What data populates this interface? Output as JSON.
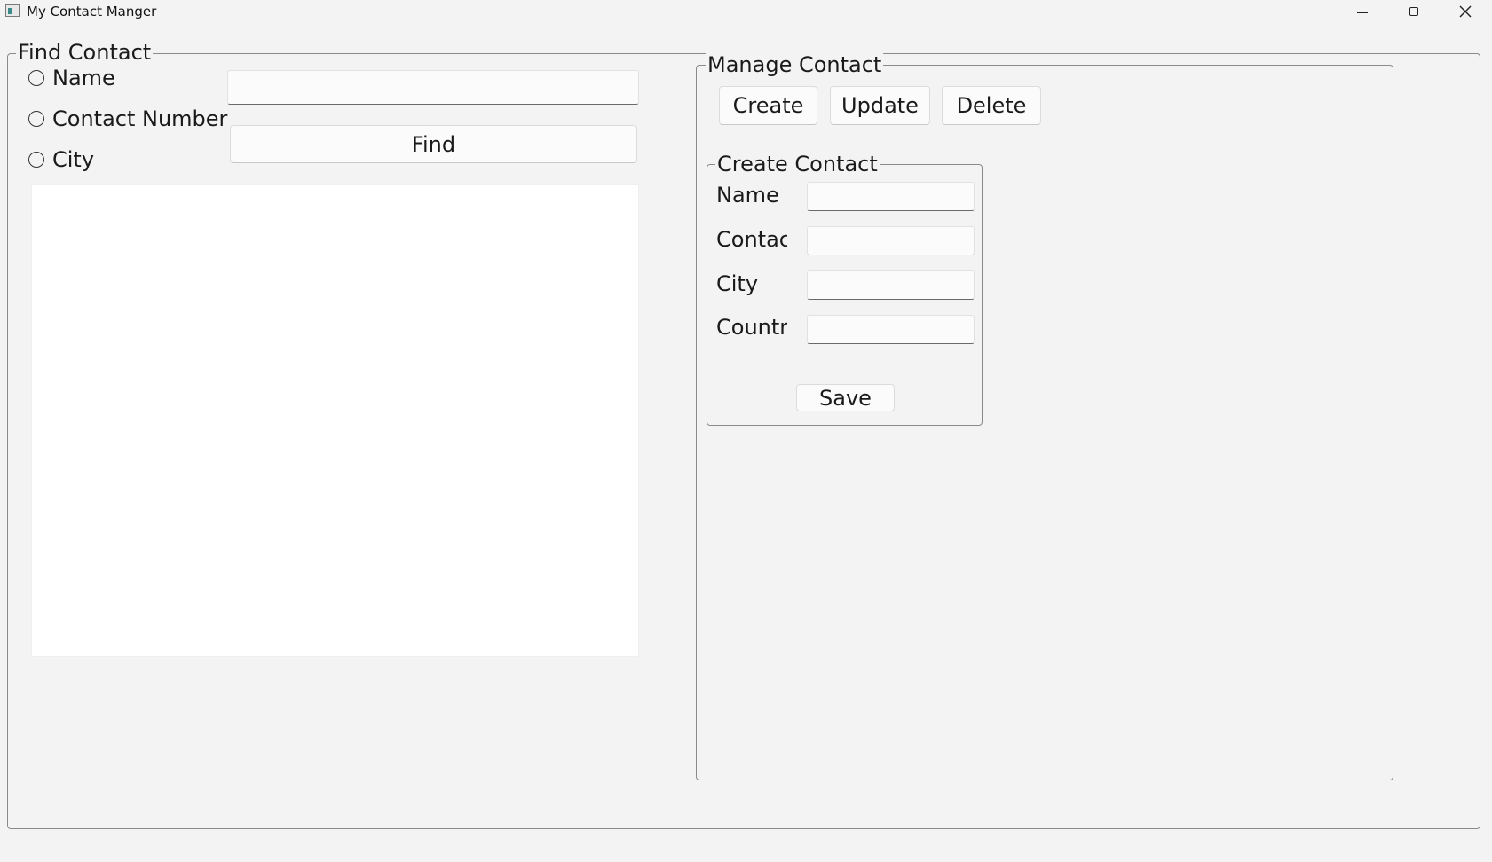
{
  "window": {
    "title": "My Contact Manger"
  },
  "find": {
    "title": "Find Contact",
    "radios": [
      {
        "label": "Name"
      },
      {
        "label": "Contact Number"
      },
      {
        "label": "City"
      }
    ],
    "search_value": "",
    "find_label": "Find"
  },
  "manage": {
    "title": "Manage Contact",
    "create_label": "Create",
    "update_label": "Update",
    "delete_label": "Delete"
  },
  "create_contact": {
    "title": "Create Contact",
    "fields": [
      {
        "label": "Name",
        "value": ""
      },
      {
        "label": "Contact Number",
        "value": ""
      },
      {
        "label": "City",
        "value": ""
      },
      {
        "label": "Country",
        "value": ""
      }
    ],
    "save_label": "Save"
  },
  "icons": {
    "minimize": "minimize-icon",
    "maximize": "maximize-icon",
    "close": "close-icon"
  }
}
